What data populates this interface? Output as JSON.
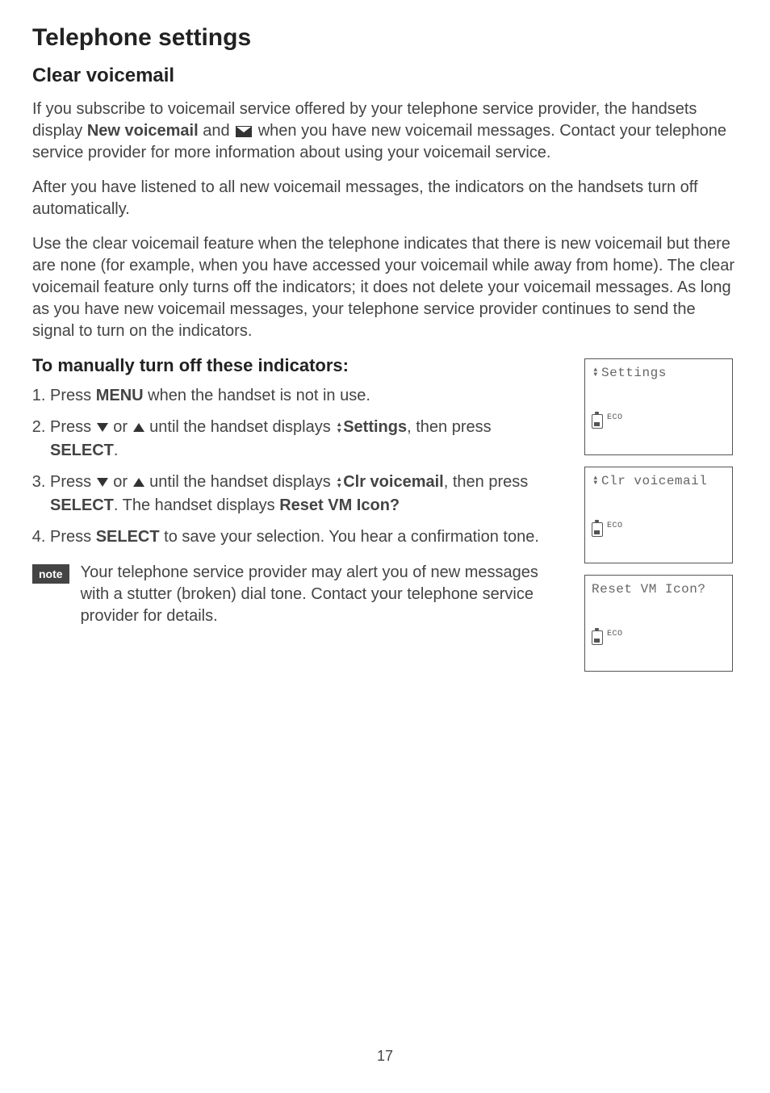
{
  "page": {
    "title": "Telephone settings",
    "section_heading": "Clear voicemail",
    "intro_part1": "If you subscribe to voicemail service offered by your telephone service provider, the handsets display ",
    "intro_bold1": "New voicemail",
    "intro_part2": " and ",
    "intro_part3": " when you have new voicemail messages. Contact your telephone service provider for more information about using your voicemail service.",
    "para2": "After you have listened to all new voicemail messages, the indicators on the handsets turn off automatically.",
    "para3": "Use the clear voicemail feature when the telephone indicates that there is new voicemail but there are none (for example, when you have accessed your voicemail while away from home). The clear voicemail feature only turns off the indicators; it does not delete your voicemail messages. As long as you have new voicemail messages, your telephone service provider continues to send the signal to turn on the indicators.",
    "sub_heading": "To manually turn off these indicators:",
    "steps": {
      "s1_a": "Press ",
      "s1_menu": "MENU",
      "s1_b": " when the handset is not in use.",
      "s2_a": "Press ",
      "s2_b": " or ",
      "s2_c": " until the handset displays ",
      "s2_settings": "Settings",
      "s2_d": ", then press ",
      "s2_select": "SELECT",
      "s2_e": ".",
      "s3_a": "Press ",
      "s3_b": " or ",
      "s3_c": " until the handset displays ",
      "s3_clr": "Clr voicemail",
      "s3_d": ", then press ",
      "s3_select": "SELECT",
      "s3_e": ". The handset displays ",
      "s3_reset": "Reset VM Icon?",
      "s4_a": "Press ",
      "s4_select": "SELECT",
      "s4_b": " to save your selection. You hear a confirmation tone."
    },
    "note_label": "note",
    "note_text": "Your telephone service provider may alert you of new messages with a stutter (broken) dial tone. Contact your telephone service provider for details.",
    "page_number": "17"
  },
  "screens": {
    "screen1": {
      "line1": "Settings",
      "eco": "ECO"
    },
    "screen2": {
      "line1": "Clr voicemail",
      "eco": "ECO"
    },
    "screen3": {
      "line1": "Reset VM Icon?",
      "eco": "ECO"
    }
  }
}
